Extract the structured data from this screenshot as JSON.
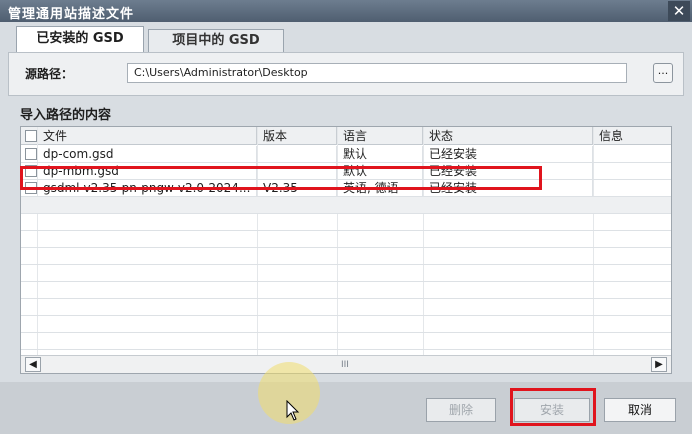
{
  "window": {
    "title": "管理通用站描述文件",
    "close": "✕"
  },
  "tabs": [
    {
      "label": "已安装的 GSD"
    },
    {
      "label": "项目中的 GSD"
    }
  ],
  "source": {
    "label": "源路径：",
    "path": "C:\\Users\\Administrator\\Desktop",
    "browse": "..."
  },
  "section_title": "导入路径的内容",
  "table": {
    "headers": [
      "文件",
      "版本",
      "语言",
      "状态",
      "信息"
    ],
    "rows": [
      {
        "file": "dp-com.gsd",
        "version": "",
        "language": "默认",
        "status": "已经安装",
        "info": ""
      },
      {
        "file": "dp-mbm.gsd",
        "version": "",
        "language": "默认",
        "status": "已经安装",
        "info": ""
      },
      {
        "file": "gsdml-v2.35-pn-pngw-v2.0-2024...",
        "version": "V2.35",
        "language": "英语, 德语",
        "status": "已经安装",
        "info": ""
      }
    ],
    "scroll_thumb": "III"
  },
  "buttons": {
    "delete": "删除",
    "install": "安装",
    "cancel": "取消"
  },
  "colors": {
    "highlight": "#e0141d",
    "titlebar": "#5a697b"
  }
}
